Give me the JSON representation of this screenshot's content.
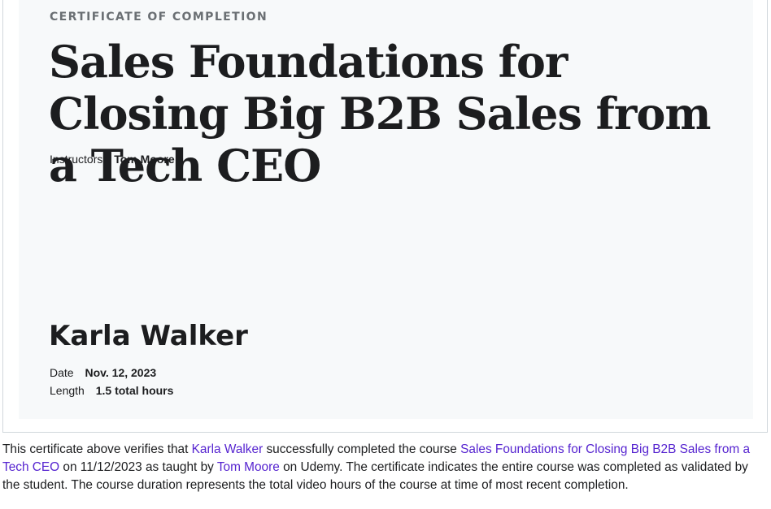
{
  "certificate": {
    "eyebrow": "CERTIFICATE OF COMPLETION",
    "course_title": "Sales Foundations for Closing Big B2B Sales from a Tech CEO",
    "instructors_label": "Instructors",
    "instructor_name": "Tom Moore",
    "student_name": "Karla Walker",
    "date_label": "Date",
    "date_value": "Nov. 12, 2023",
    "length_label": "Length",
    "length_value": "1.5 total hours"
  },
  "description": {
    "part1": "This certificate above verifies that ",
    "student_link": "Karla Walker",
    "part2": " successfully completed the course ",
    "course_link": "Sales Foundations for Closing Big B2B Sales from a Tech CEO",
    "part3": " on 11/12/2023 as taught by ",
    "instructor_link": "Tom Moore",
    "part4": " on Udemy. The certificate indicates the entire course was completed as validated by the student. The course duration represents the total video hours of the course at time of most recent completion."
  },
  "colors": {
    "link": "#5624d0",
    "certificate_bg": "#f7f9fa",
    "text": "#1c1d1f",
    "muted": "#6a6f73"
  }
}
